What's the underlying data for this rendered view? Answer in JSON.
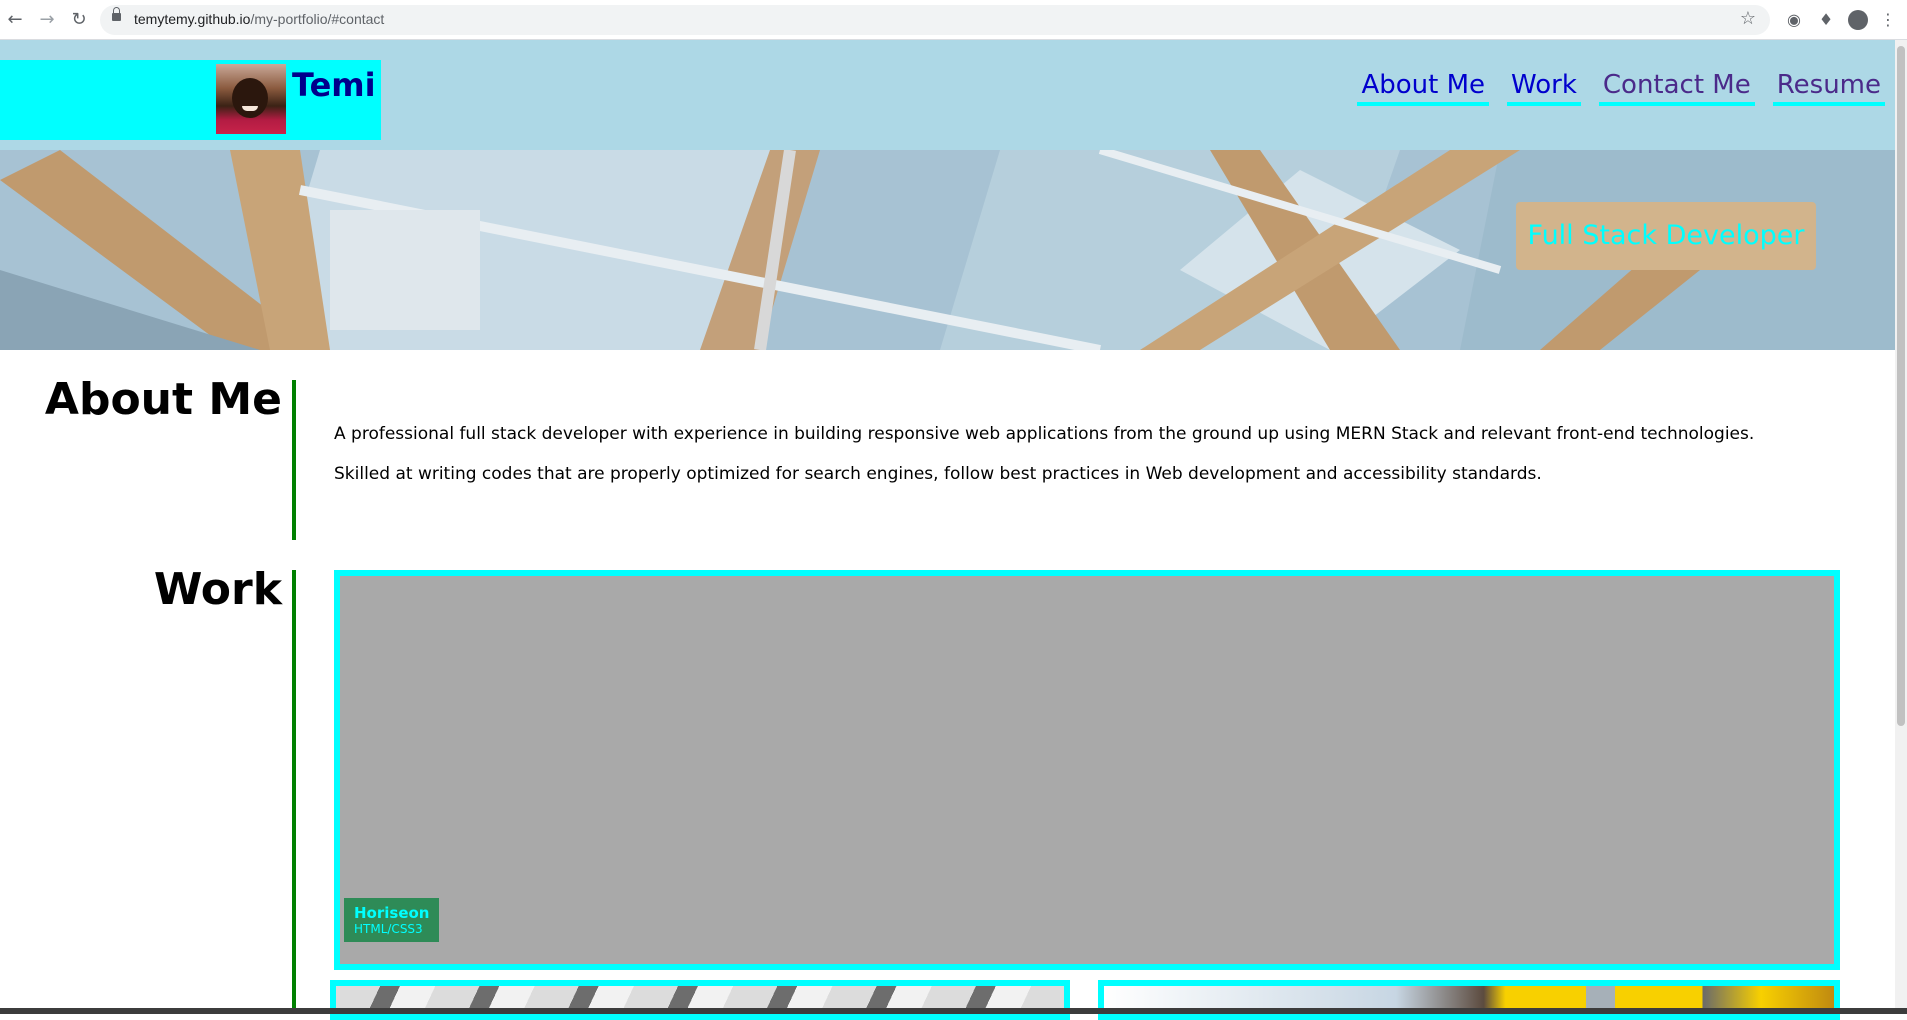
{
  "browser": {
    "url_host": "temytemy.github.io",
    "url_path": "/my-portfolio/#contact",
    "icons": [
      "back-arrow-icon",
      "forward-arrow-icon",
      "reload-icon",
      "lock-icon",
      "star-icon",
      "extension-icon",
      "puzzle-icon",
      "profile-icon",
      "kebab-menu-icon"
    ]
  },
  "header": {
    "brand_name": "Temi",
    "nav": [
      {
        "label": "About Me"
      },
      {
        "label": "Work"
      },
      {
        "label": "Contact Me"
      },
      {
        "label": "Resume"
      }
    ]
  },
  "hero": {
    "badge": "Full Stack Developer"
  },
  "about": {
    "title": "About Me",
    "paragraphs": [
      "A professional full stack developer with experience in building responsive web applications from the ground up using MERN Stack and relevant front-end technologies.",
      "Skilled at writing codes that are properly optimized for search engines, follow best practices in Web development and accessibility standards."
    ]
  },
  "work": {
    "title": "Work",
    "featured": {
      "name": "Horiseon",
      "tech": "HTML/CSS3"
    }
  },
  "colors": {
    "header_bg": "#add8e6",
    "brand_bg": "#00ffff",
    "brand_text": "#00008b",
    "nav_link": "#0000cd",
    "hero_badge_bg": "#d2b48c",
    "section_divider": "#008000",
    "project_tag_bg": "#2e8b57"
  }
}
